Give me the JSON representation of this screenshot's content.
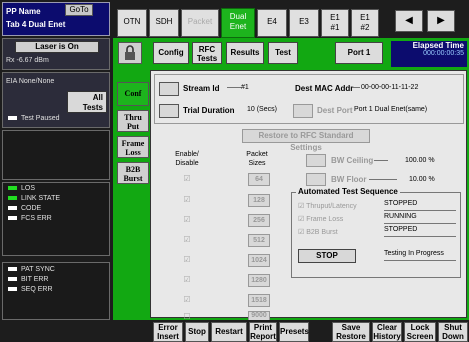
{
  "left": {
    "pp_name": "PP Name",
    "goto": "GoTo",
    "tab_line": "Tab 4 Dual Enet",
    "laser": "Laser is On",
    "rx": "Rx -6.67 dBm",
    "eia": "EIA None/None",
    "all_tests_1": "All",
    "all_tests_2": "Tests",
    "test_paused": "Test Paused",
    "status": [
      "LOS",
      "LINK STATE",
      "CODE",
      "FCS ERR"
    ],
    "pat": [
      "PAT SYNC",
      "BIT ERR",
      "SEQ ERR"
    ]
  },
  "tabs": {
    "otn": "OTN",
    "sdh": "SDH",
    "packet": "Packet",
    "dual_1": "Dual",
    "dual_2": "Enet",
    "e4": "E4",
    "e3": "E3",
    "e1a_1": "E1",
    "e1a_2": "#1",
    "e1b_1": "E1",
    "e1b_2": "#2",
    "prev": "◀",
    "next": "▶"
  },
  "toolbar": {
    "config": "Config",
    "rfc_1": "RFC",
    "rfc_2": "Tests",
    "results": "Results",
    "test": "Test",
    "port": "Port 1",
    "elapsed_label": "Elapsed Time",
    "elapsed_value": "000:00:00:35"
  },
  "side_tabs": {
    "conf": "Conf",
    "thru_1": "Thru",
    "thru_2": "Put",
    "frame_1": "Frame",
    "frame_2": "Loss",
    "b2b_1": "B2B",
    "b2b_2": "Burst"
  },
  "stream": {
    "stream_id_label": "Stream Id",
    "stream_id_value": "#1",
    "dest_mac_label": "Dest MAC Addr",
    "dest_mac_value": "00-00-00-11-11-22",
    "trial_label": "Trial Duration",
    "trial_value": "10 (Secs)",
    "dest_port_label": "Dest Port",
    "dest_port_value": "Port 1 Dual Enet(same)"
  },
  "restore": "Restore to RFC Standard Settings",
  "headers": {
    "enable_1": "Enable/",
    "enable_2": "Disable",
    "packet_1": "Packet",
    "packet_2": "Sizes"
  },
  "packet_sizes": [
    "64",
    "128",
    "256",
    "512",
    "1024",
    "1280",
    "1518",
    "9000"
  ],
  "bw": {
    "ceiling_label": "BW Ceiling",
    "ceiling_value": "100.00 %",
    "floor_label": "BW Floor",
    "floor_value": "10.00 %"
  },
  "ats": {
    "title": "Automated Test Sequence",
    "rows": [
      {
        "label": "Thruput/Latency",
        "value": "STOPPED"
      },
      {
        "label": "Frame Loss",
        "value": "RUNNING"
      },
      {
        "label": "B2B Burst",
        "value": "STOPPED"
      }
    ],
    "stop": "STOP",
    "progress": "Testing In Progress"
  },
  "bottom": {
    "error_1": "Error",
    "error_2": "Insert",
    "stop": "Stop",
    "restart": "Restart",
    "print_1": "Print",
    "print_2": "Report",
    "presets": "Presets",
    "save_1": "Save",
    "save_2": "Restore",
    "clear_1": "Clear",
    "clear_2": "History",
    "lock_1": "Lock",
    "lock_2": "Screen",
    "shut_1": "Shut",
    "shut_2": "Down"
  },
  "colors": {
    "main_green": "#12a812",
    "active_tab": "#1db41d",
    "header_blue": "#0c0c6e",
    "led_green": "#22dd22"
  },
  "icons": {
    "lock": "lock-icon",
    "led": "led-indicator"
  }
}
